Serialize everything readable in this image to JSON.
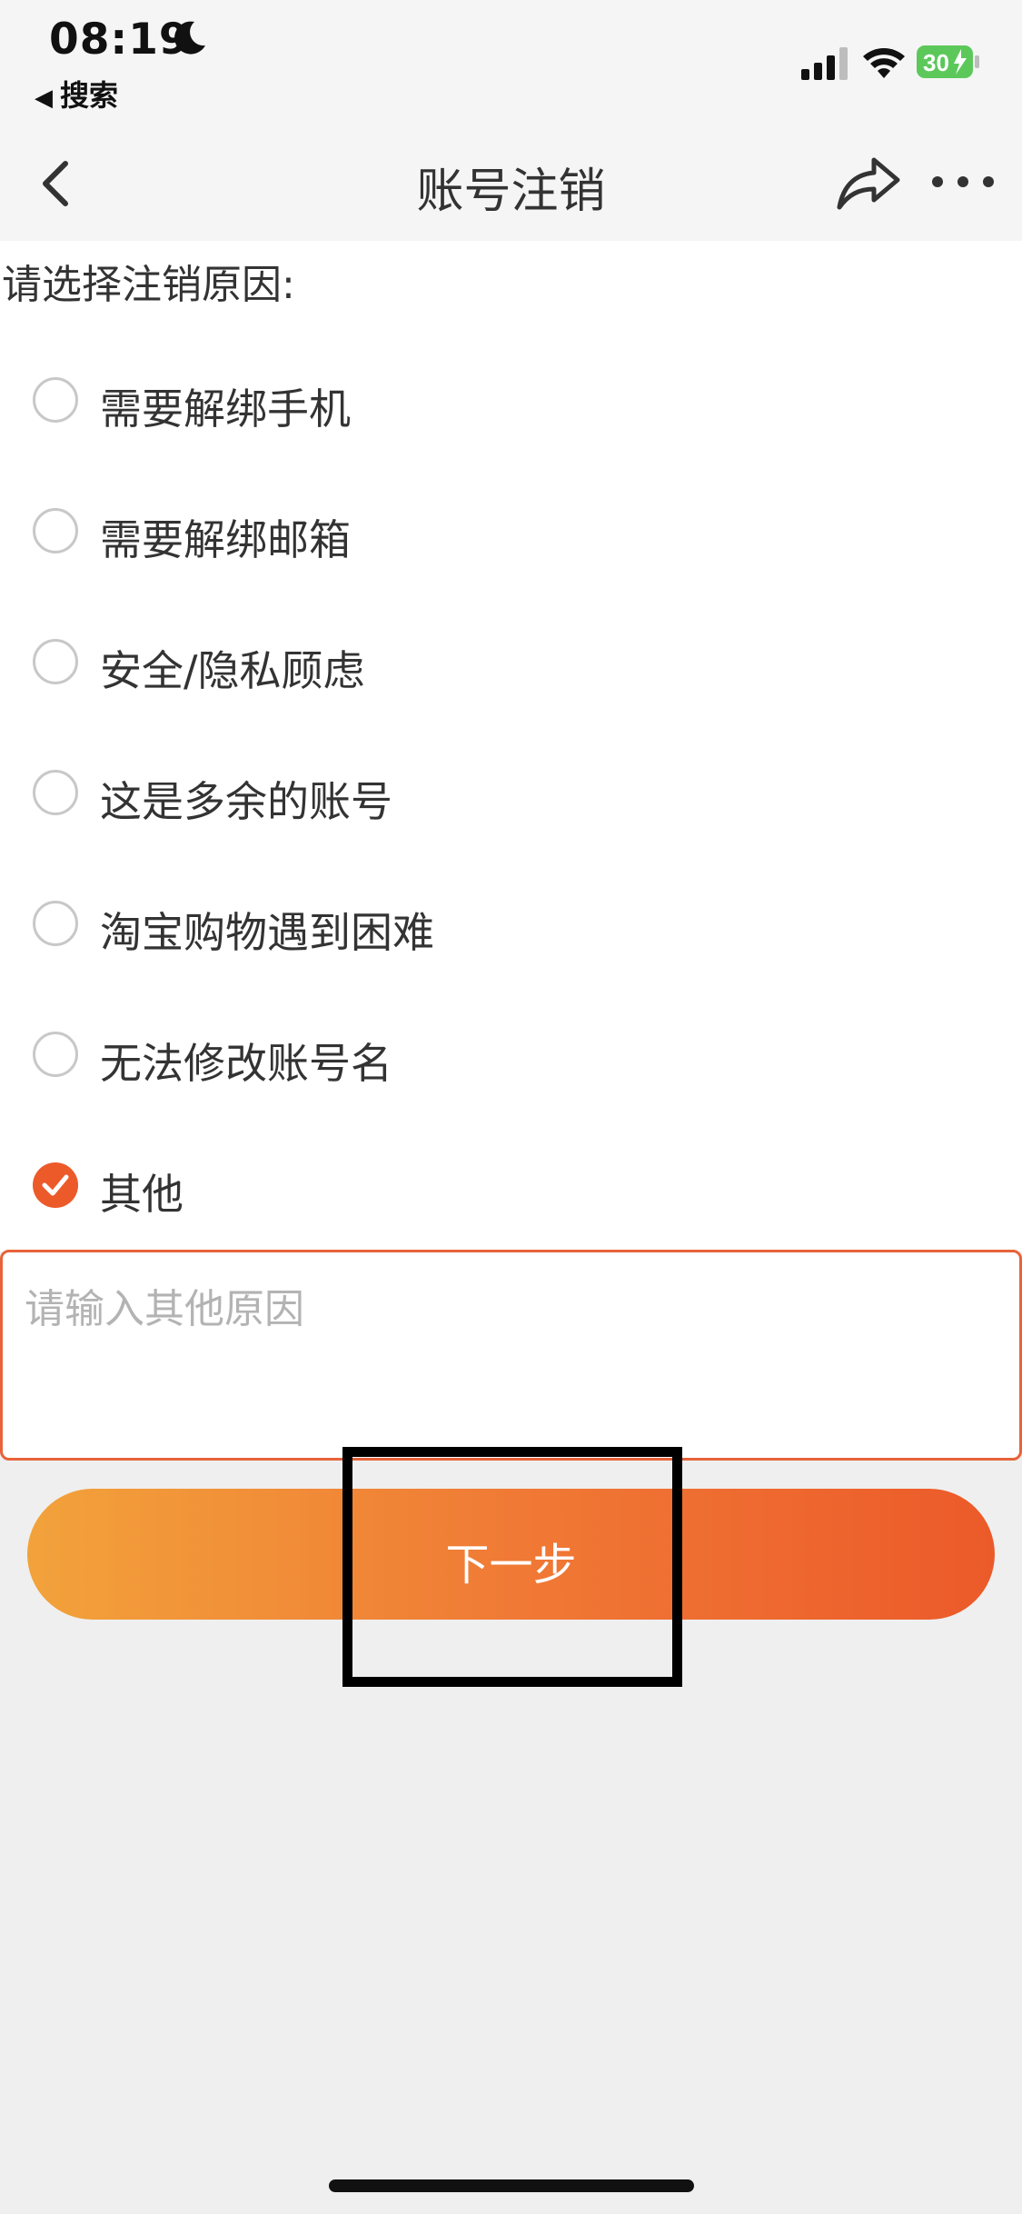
{
  "status_bar": {
    "time": "08:19",
    "back_app_arrow": "◀",
    "back_app_label": "搜索",
    "battery_level": "30",
    "icons": [
      "moon-icon",
      "signal-icon",
      "wifi-icon",
      "battery-charging-icon"
    ]
  },
  "nav": {
    "title": "账号注销",
    "icons": [
      "back-chevron-icon",
      "share-icon",
      "more-icon"
    ]
  },
  "form": {
    "prompt": "请选择注销原因:",
    "options": [
      {
        "label": "需要解绑手机",
        "checked": false
      },
      {
        "label": "需要解绑邮箱",
        "checked": false
      },
      {
        "label": "安全/隐私顾虑",
        "checked": false
      },
      {
        "label": "这是多余的账号",
        "checked": false
      },
      {
        "label": "淘宝购物遇到困难",
        "checked": false
      },
      {
        "label": "无法修改账号名",
        "checked": false
      },
      {
        "label": "其他",
        "checked": true
      }
    ],
    "other_placeholder": "请输入其他原因",
    "next_label": "下一步"
  },
  "colors": {
    "accent": "#ec5a2a",
    "button_gradient_start": "#f2a23b",
    "button_gradient_end": "#ec5a2a",
    "battery_green": "#5cc85a"
  }
}
